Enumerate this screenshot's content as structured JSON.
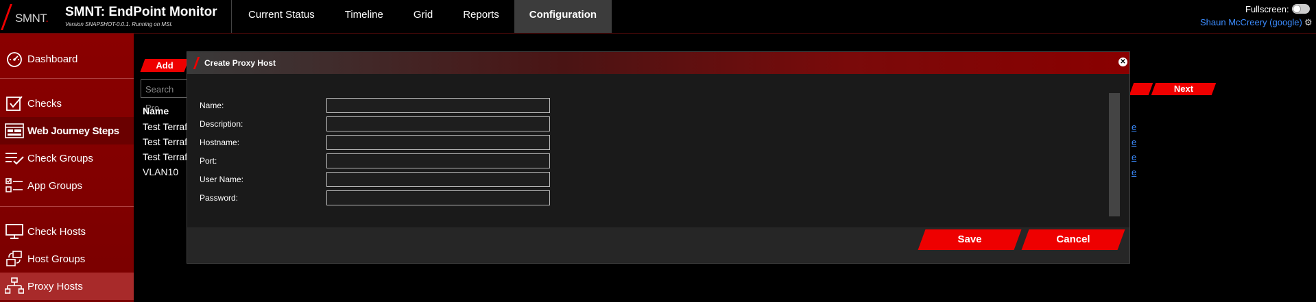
{
  "header": {
    "logo_text": "SMNT",
    "logo_dot": ".",
    "title": "SMNT: EndPoint Monitor",
    "subtitle": "Version SNAPSHOT-0.0.1. Running on MSI.",
    "fullscreen_label": "Fullscreen:",
    "user": "Shaun McCreery (google)"
  },
  "nav": {
    "tabs": [
      {
        "label": "Current Status"
      },
      {
        "label": "Timeline"
      },
      {
        "label": "Grid"
      },
      {
        "label": "Reports"
      },
      {
        "label": "Configuration"
      }
    ],
    "active": "Configuration"
  },
  "sidebar": {
    "items": [
      {
        "label": "Dashboard",
        "icon": "dashboard-icon"
      },
      {
        "label": "Checks",
        "icon": "checkbox-icon"
      },
      {
        "label": "Web Journey Steps",
        "icon": "browser-icon"
      },
      {
        "label": "Check Groups",
        "icon": "checklist-icon"
      },
      {
        "label": "App Groups",
        "icon": "app-groups-icon"
      },
      {
        "label": "Check Hosts",
        "icon": "monitor-icon"
      },
      {
        "label": "Host Groups",
        "icon": "host-groups-icon"
      },
      {
        "label": "Proxy Hosts",
        "icon": "network-icon"
      }
    ],
    "active": "Proxy Hosts"
  },
  "page": {
    "add_label": "Add",
    "search_placeholder": "Search Pro",
    "name_header": "Name",
    "rows": [
      "Test Terrafo",
      "Test Terrafo",
      "Test Terrafo",
      "VLAN10"
    ],
    "next_label": "Next",
    "row_links": [
      "e",
      "e",
      "e",
      "e"
    ]
  },
  "modal": {
    "title": "Create Proxy Host",
    "fields": [
      {
        "label": "Name:",
        "value": ""
      },
      {
        "label": "Description:",
        "value": ""
      },
      {
        "label": "Hostname:",
        "value": ""
      },
      {
        "label": "Port:",
        "value": ""
      },
      {
        "label": "User Name:",
        "value": ""
      },
      {
        "label": "Password:",
        "value": ""
      }
    ],
    "save_label": "Save",
    "cancel_label": "Cancel"
  },
  "colors": {
    "accent": "#ee0000",
    "sidebar": "#7a0000",
    "link": "#3b8cff"
  }
}
